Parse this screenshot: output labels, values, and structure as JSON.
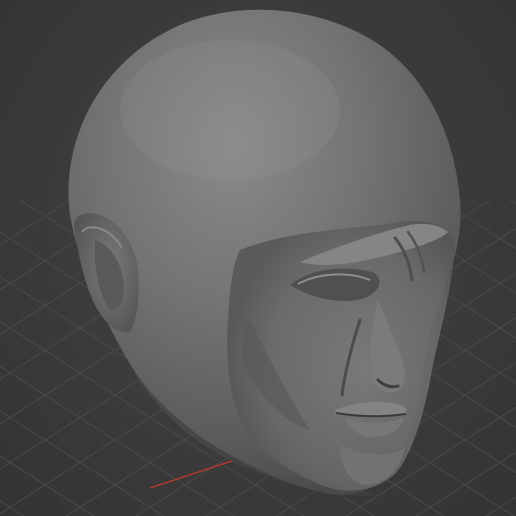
{
  "viewport": {
    "background_color": "#3a3a3a",
    "grid_color": "#4a4a4a",
    "x_axis_color": "#c0392b",
    "model_base_color": "#6e6e6e"
  },
  "model": {
    "icon": "sculpted-head-model"
  }
}
